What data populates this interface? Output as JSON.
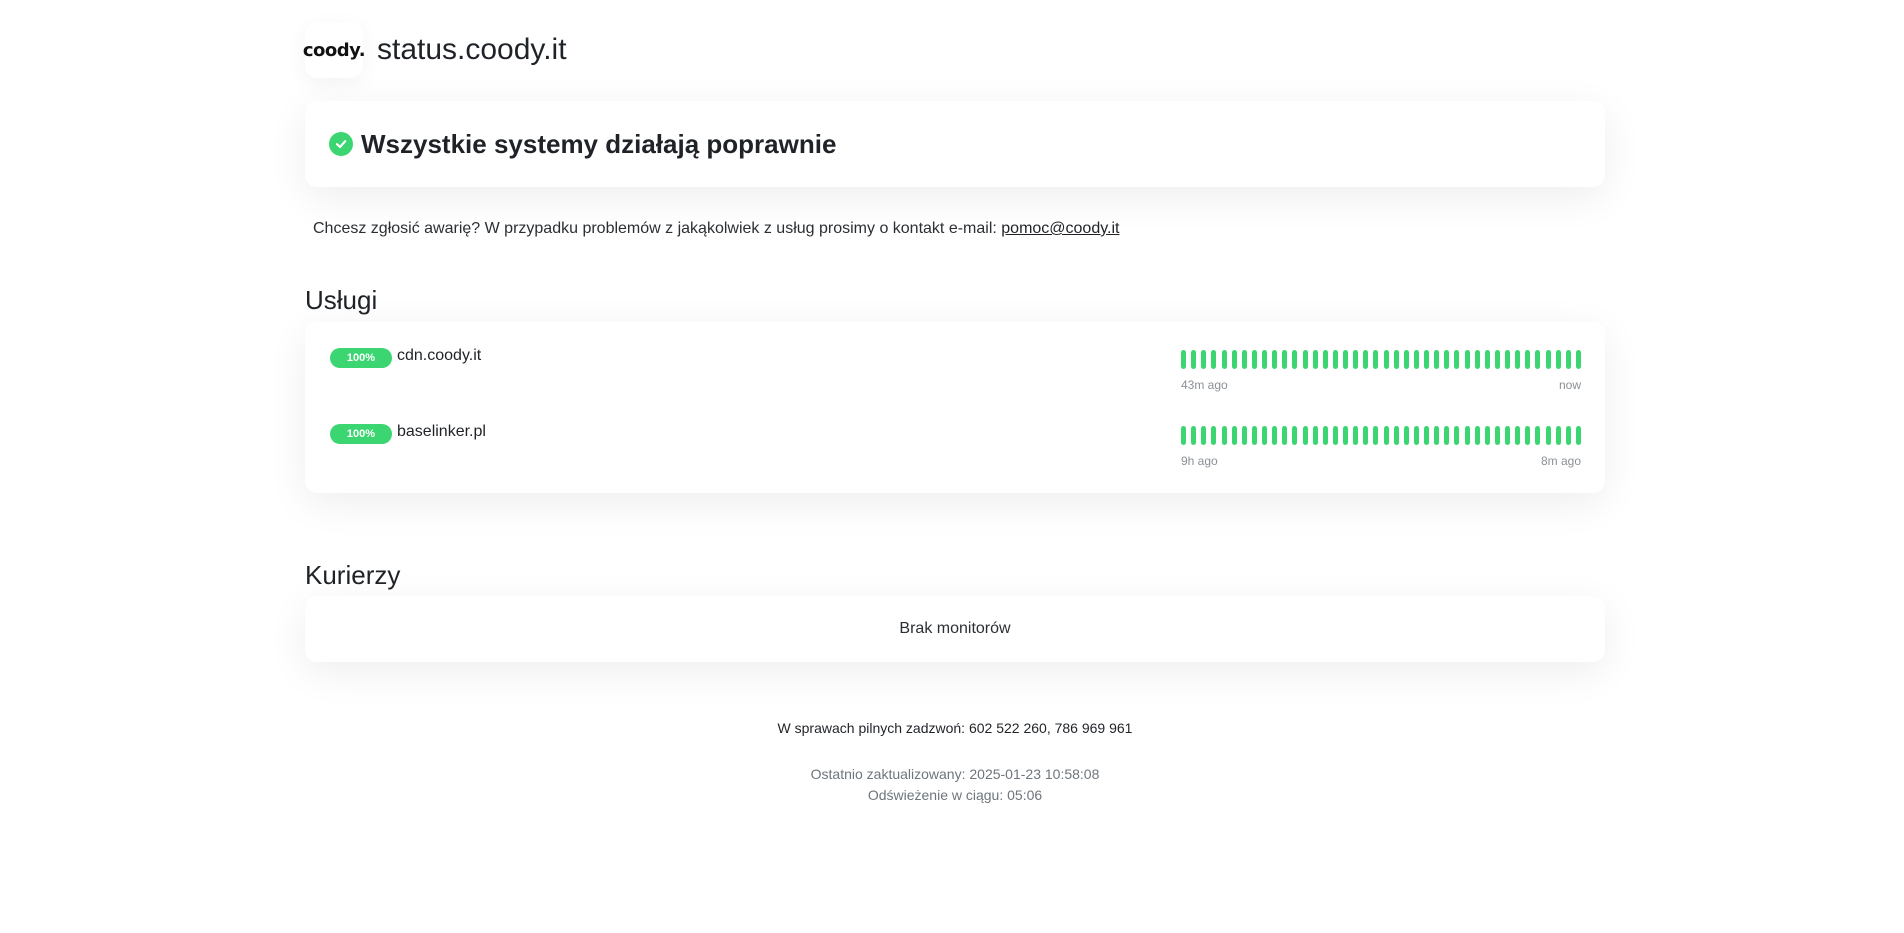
{
  "header": {
    "logo_text": "coody.",
    "title": "status.coody.it"
  },
  "status": {
    "icon": "check-circle-icon",
    "text": "Wszystkie systemy działają poprawnie",
    "color": "#3bd671"
  },
  "report": {
    "text": "Chcesz zgłosić awarię? W przypadku problemów z jakąkolwiek z usług prosimy o kontakt e-mail: ",
    "email": "pomoc@coody.it"
  },
  "sections": {
    "services": {
      "title": "Usługi",
      "monitors": [
        {
          "uptime": "100%",
          "name": "cdn.coody.it",
          "time_start": "43m ago",
          "time_end": "now",
          "bars": 40
        },
        {
          "uptime": "100%",
          "name": "baselinker.pl",
          "time_start": "9h ago",
          "time_end": "8m ago",
          "bars": 40
        }
      ]
    },
    "couriers": {
      "title": "Kurierzy",
      "empty_text": "Brak monitorów"
    }
  },
  "footer": {
    "phone_text": "W sprawach pilnych zadzwoń: 602 522 260, 786 969 961",
    "updated_text": "Ostatnio zaktualizowany: 2025-01-23 10:58:08",
    "refresh_text": "Odświeżenie w ciągu: 05:06"
  }
}
